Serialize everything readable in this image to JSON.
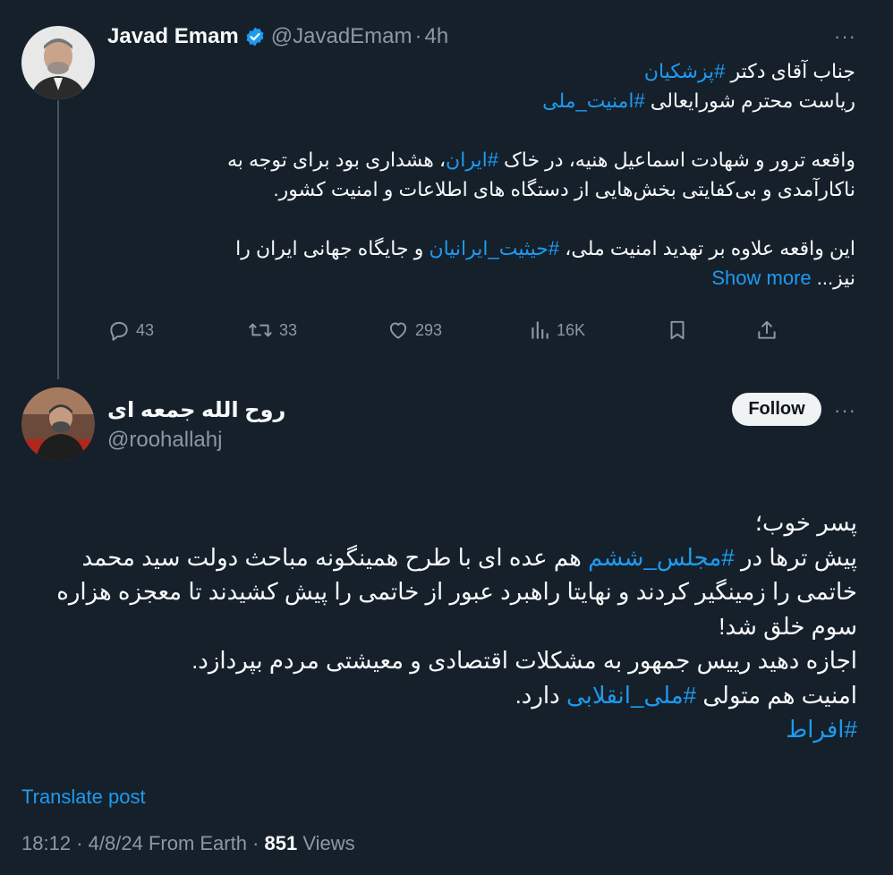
{
  "original_post": {
    "author_name": "Javad Emam",
    "handle": "@JavadEmam",
    "time_sep": "·",
    "time": "4h",
    "more": "···",
    "lines": [
      [
        {
          "t": "جناب آقای دکتر "
        },
        {
          "t": "#پزشکیان",
          "tag": true
        }
      ],
      [
        {
          "t": "ریاست محترم شورایعالی "
        },
        {
          "t": "#امنیت_ملی",
          "tag": true
        }
      ],
      [],
      [
        {
          "t": "واقعه ترور و شهادت اسماعیل هنیه، در خاک "
        },
        {
          "t": "#ایران",
          "tag": true
        },
        {
          "t": "، هشداری بود برای توجه به"
        }
      ],
      [
        {
          "t": "ناکارآمدی و بی‌کفایتی بخش‌هایی از دستگاه های اطلاعات و امنیت کشور."
        }
      ],
      [],
      [
        {
          "t": "این واقعه علاوه بر تهدید امنیت ملی، "
        },
        {
          "t": "#حیثیت_ایرانیان",
          "tag": true
        },
        {
          "t": " و جایگاه جهانی ایران را"
        }
      ],
      [
        {
          "t": "نیز... "
        },
        {
          "t": "Show more",
          "tag": true
        }
      ]
    ],
    "stats": {
      "replies": "43",
      "reposts": "33",
      "likes": "293",
      "views": "16K"
    }
  },
  "reply_post": {
    "author_name": "روح الله جمعه ای",
    "handle": "@roohallahj",
    "follow_label": "Follow",
    "more": "···",
    "lines": [
      [
        {
          "t": "پسر خوب؛"
        }
      ],
      [
        {
          "t": "پیش ترها در "
        },
        {
          "t": "#مجلس_ششم",
          "tag": true
        },
        {
          "t": " هم عده ای با طرح همینگونه مباحث دولت سید محمد"
        }
      ],
      [
        {
          "t": "خاتمی را زمینگیر کردند و نهایتا راهبرد عبور از خاتمی را پیش کشیدند تا معجزه هزاره"
        }
      ],
      [
        {
          "t": "سوم خلق شد!"
        }
      ],
      [
        {
          "t": "اجازه دهید رییس جمهور به مشکلات اقتصادی و معیشتی مردم بپردازد."
        }
      ],
      [
        {
          "t": "امنیت هم متولی "
        },
        {
          "t": "#ملی_انقلابی",
          "tag": true
        },
        {
          "t": " دارد."
        }
      ],
      [
        {
          "t": "#افراط",
          "tag": true
        }
      ]
    ],
    "translate_label": "Translate post",
    "time": "18:12",
    "sep1": "·",
    "date": "4/8/24",
    "source": "From Earth",
    "sep2": "·",
    "views_count": "851",
    "views_label": "Views"
  },
  "colors": {
    "background": "#15202b",
    "accent": "#1d9bf0",
    "text": "#f7f9f9",
    "muted": "#8b98a5",
    "verified": "#1d9bf0"
  },
  "icons": [
    "verified-badge-icon",
    "reply-icon",
    "repost-icon",
    "like-icon",
    "views-icon",
    "bookmark-icon",
    "share-icon",
    "more-icon"
  ]
}
